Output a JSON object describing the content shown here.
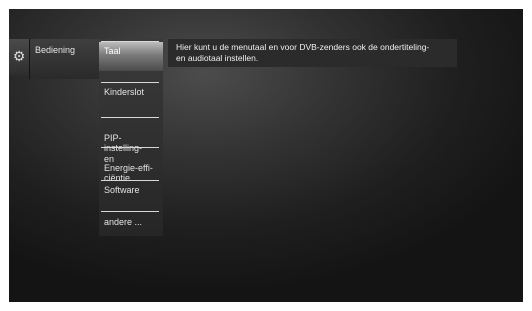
{
  "menu": {
    "category_icon": "gear-icon",
    "category_label": "Bediening",
    "items": [
      {
        "label": "Taal",
        "selected": true
      },
      {
        "label": "Kinderslot",
        "selected": false
      },
      {
        "label": "PIP-instelling-\nen",
        "selected": false
      },
      {
        "label": "Energie-effi-\nciëntie",
        "selected": false
      },
      {
        "label": "Software",
        "selected": false
      },
      {
        "label": "andere ...",
        "selected": false
      }
    ]
  },
  "info": {
    "text": "Hier kunt u de menutaal en voor DVB-zenders ook de ondertiteling-\nen audiotaal instellen."
  }
}
